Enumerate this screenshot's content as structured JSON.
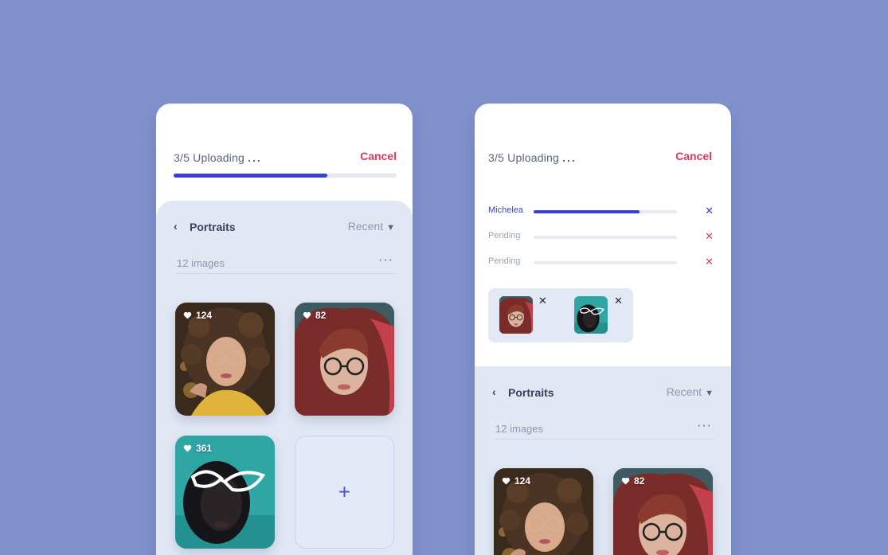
{
  "upload": {
    "status": "3/5 Uploading",
    "dots": "...",
    "cancel_label": "Cancel",
    "progress": 0.69
  },
  "files": [
    {
      "name": "Michelea",
      "progress": 0.74,
      "active": true
    },
    {
      "name": "Pending",
      "progress": 0,
      "active": false
    },
    {
      "name": "Pending",
      "progress": 0,
      "active": false
    }
  ],
  "gallery": {
    "back_glyph": "‹",
    "title": "Portraits",
    "sort": "Recent",
    "count": "12 images",
    "more": "···",
    "add_glyph": "+",
    "tiles": [
      {
        "likes": "124",
        "subject": "curly-hair-woman-yellow"
      },
      {
        "likes": "82",
        "subject": "red-hair-woman-glasses"
      },
      {
        "likes": "361",
        "subject": "woman-white-cat-eye-glasses"
      }
    ]
  },
  "colors": {
    "background": "#8292cd",
    "accent": "#3d3fd4",
    "cancel": "#e8365e",
    "panel": "#e1e8f4"
  },
  "icons": {
    "back": "chevron-left-icon",
    "sort": "chevron-down-icon",
    "more": "more-icon",
    "like": "heart-icon",
    "remove": "close-icon",
    "add": "plus-icon"
  }
}
